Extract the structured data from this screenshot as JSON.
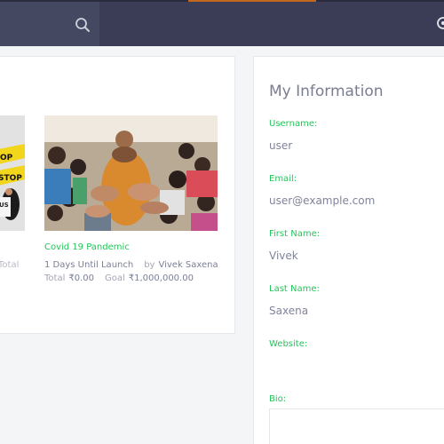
{
  "campaigns": {
    "left_card": {
      "sign_texts": [
        "OP",
        "STOP",
        "US"
      ],
      "meta_total_label": "Total"
    },
    "main_card": {
      "title": "Covid 19 Pandemic",
      "days_text": "1 Days Until Launch",
      "by_label": "by",
      "author": "Vivek Saxena",
      "total_label": "Total",
      "total_value": "₹0.00",
      "goal_label": "Goal",
      "goal_value": "₹1,000,000.00"
    }
  },
  "info": {
    "title": "My Information",
    "username_label": "Username:",
    "username_value": "user",
    "email_label": "Email:",
    "email_value": "user@example.com",
    "first_name_label": "First Name:",
    "first_name_value": "Vivek",
    "last_name_label": "Last Name:",
    "last_name_value": "Saxena",
    "website_label": "Website:",
    "bio_label": "Bio:"
  },
  "colors": {
    "header": "#3a3d55",
    "accent": "#c2681e",
    "label_green": "#23c55a"
  },
  "icons": {
    "search": "search-icon",
    "settings": "gear-icon"
  }
}
